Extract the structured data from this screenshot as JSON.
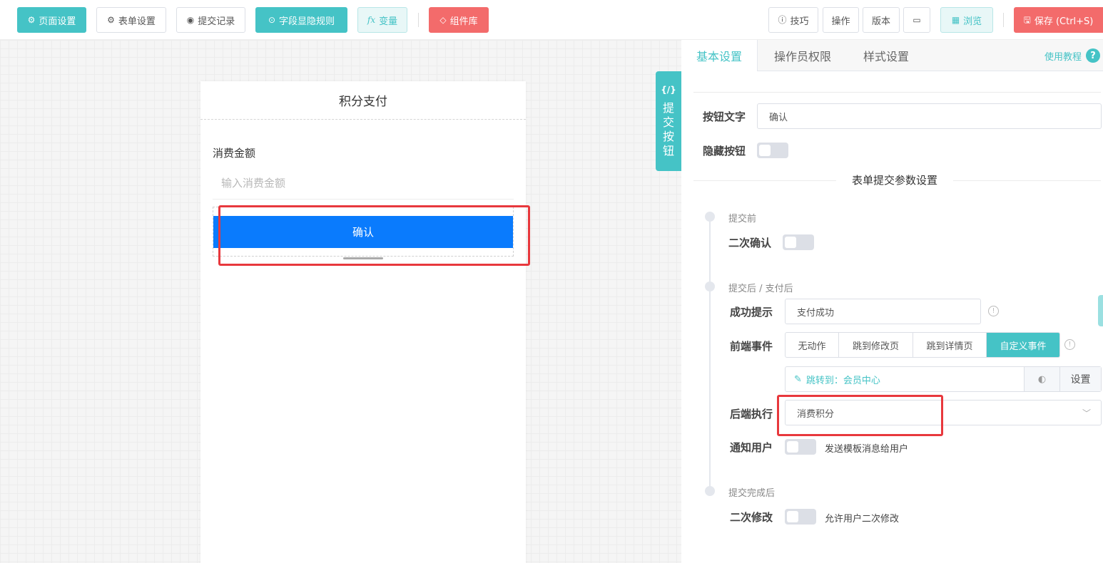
{
  "toolbar": {
    "page_settings": "页面设置",
    "form_settings": "表单设置",
    "submit_records": "提交记录",
    "field_rules": "字段显隐规则",
    "variables": "变量",
    "variables_prefix": "fx",
    "component_lib": "组件库",
    "tips": "技巧",
    "operations": "操作",
    "version": "版本",
    "preview": "浏览",
    "save": "保存 (Ctrl+S)"
  },
  "phone": {
    "title": "积分支付",
    "field_label": "消费金额",
    "field_placeholder": "输入消费金额",
    "confirm_button": "确认"
  },
  "side_tab": {
    "code": "{/}",
    "chars": [
      "提",
      "交",
      "按",
      "钮"
    ]
  },
  "panel": {
    "tabs": [
      "基本设置",
      "操作员权限",
      "样式设置"
    ],
    "tutorial": "使用教程",
    "button_text_label": "按钮文字",
    "button_text_value": "确认",
    "hide_button_label": "隐藏按钮",
    "section_title": "表单提交参数设置",
    "before_submit": "提交前",
    "second_confirm_label": "二次确认",
    "after_submit": "提交后 / 支付后",
    "success_tip_label": "成功提示",
    "success_tip_value": "支付成功",
    "frontend_event_label": "前端事件",
    "frontend_events": [
      "无动作",
      "跳到修改页",
      "跳到详情页",
      "自定义事件"
    ],
    "jump_text": "跳转到：会员中心",
    "settings_button": "设置",
    "backend_exec_label": "后端执行",
    "backend_exec_value": "消费积分",
    "notify_user_label": "通知用户",
    "notify_user_desc": "发送模板消息给用户",
    "after_complete": "提交完成后",
    "second_edit_label": "二次修改",
    "second_edit_desc": "允许用户二次修改"
  },
  "colors": {
    "accent": "#45c3c6",
    "danger": "#f36b6b",
    "primary_button": "#0a7bfd",
    "highlight_box": "#e8383d"
  }
}
